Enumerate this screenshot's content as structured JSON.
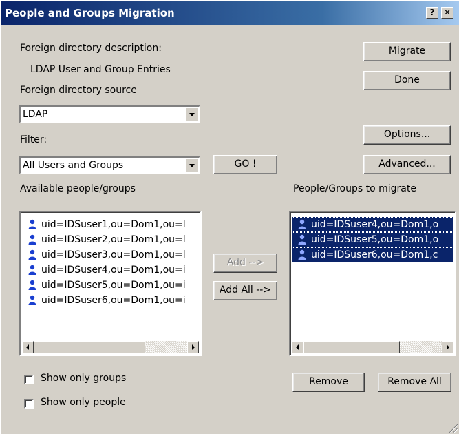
{
  "window": {
    "title": "People and Groups Migration",
    "help_label": "?",
    "close_label": "✕"
  },
  "labels": {
    "foreign_desc_label": "Foreign directory description:",
    "foreign_desc_value": "LDAP User and Group Entries",
    "foreign_source_label": "Foreign directory source",
    "filter_label": "Filter:",
    "available_label": "Available people/groups",
    "to_migrate_label": "People/Groups to migrate"
  },
  "source_combo": {
    "value": "LDAP"
  },
  "filter_combo": {
    "value": "All Users and Groups"
  },
  "buttons": {
    "migrate": "Migrate",
    "done": "Done",
    "options": "Options...",
    "advanced": "Advanced...",
    "go": "GO !",
    "add": "Add -->",
    "add_all": "Add All -->",
    "remove": "Remove",
    "remove_all": "Remove All"
  },
  "available_list": [
    "uid=IDSuser1,ou=Dom1,ou=l",
    "uid=IDSuser2,ou=Dom1,ou=l",
    "uid=IDSuser3,ou=Dom1,ou=l",
    "uid=IDSuser4,ou=Dom1,ou=i",
    "uid=IDSuser5,ou=Dom1,ou=i",
    "uid=IDSuser6,ou=Dom1,ou=i"
  ],
  "migrate_list": [
    "uid=IDSuser4,ou=Dom1,o",
    "uid=IDSuser5,ou=Dom1,o",
    "uid=IDSuser6,ou=Dom1,c"
  ],
  "checkboxes": {
    "groups_only": "Show only groups",
    "people_only": "Show only people"
  },
  "colors": {
    "selection": "#0a246a",
    "user_icon": "#1a3fd0",
    "face": "#d4d0c8"
  },
  "icons": {
    "list_item_icon": "user-icon"
  }
}
